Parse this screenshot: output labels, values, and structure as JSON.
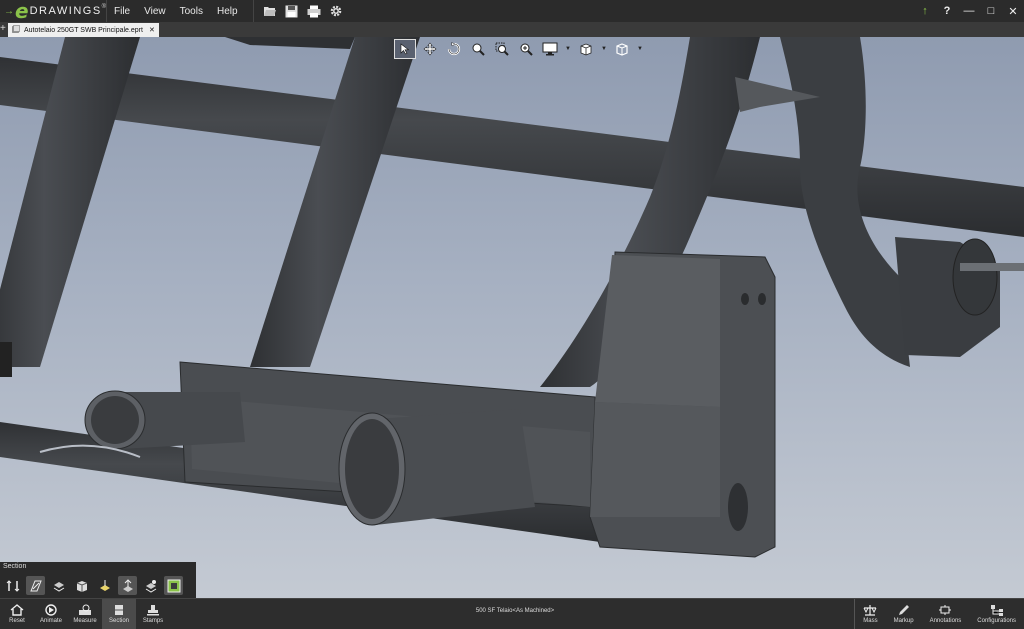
{
  "app": {
    "logo_word": "DRAWINGS",
    "logo_e": "e",
    "logo_mark": "®"
  },
  "menu": [
    "File",
    "View",
    "Tools",
    "Help"
  ],
  "toolbar_icons": [
    "open-icon",
    "save-icon",
    "print-icon",
    "settings-icon"
  ],
  "window": {
    "upgrade": "↑",
    "help": "?",
    "min": "—",
    "max": "□",
    "close": "✕"
  },
  "document_tab": {
    "label": "Autotelaio 250GT SWB Principale.eprt",
    "close": "✕"
  },
  "view_tools": [
    "select-icon",
    "pan-icon",
    "rotate-icon",
    "zoom-to-fit-icon",
    "zoom-to-area-icon",
    "zoom-icon",
    "display-style-icon",
    "view-orientation-icon",
    "visibility-icon"
  ],
  "section": {
    "title": "Section",
    "tools": [
      "flip-section-icon",
      "section-plane-icon",
      "section-x-icon",
      "section-cube-icon",
      "section-y-icon",
      "section-z-icon",
      "section-offset-icon",
      "cap-section-icon"
    ]
  },
  "bottom_left": [
    {
      "label": "Reset",
      "icon": "home-icon"
    },
    {
      "label": "Animate",
      "icon": "animate-icon"
    },
    {
      "label": "Measure",
      "icon": "measure-icon"
    },
    {
      "label": "Section",
      "icon": "section-icon"
    },
    {
      "label": "Stamps",
      "icon": "stamps-icon"
    }
  ],
  "status": "500 SF Telaio<As Machined>",
  "bottom_right": [
    {
      "label": "Mass",
      "icon": "mass-icon"
    },
    {
      "label": "Markup",
      "icon": "markup-icon"
    },
    {
      "label": "Annotations",
      "icon": "annotations-icon"
    },
    {
      "label": "Configurations",
      "icon": "configurations-icon"
    }
  ],
  "colors": {
    "accent": "#8bc34a",
    "tube": "#3a3c3f",
    "background_top": "#8f9bb0",
    "background_bottom": "#c4cad3"
  }
}
